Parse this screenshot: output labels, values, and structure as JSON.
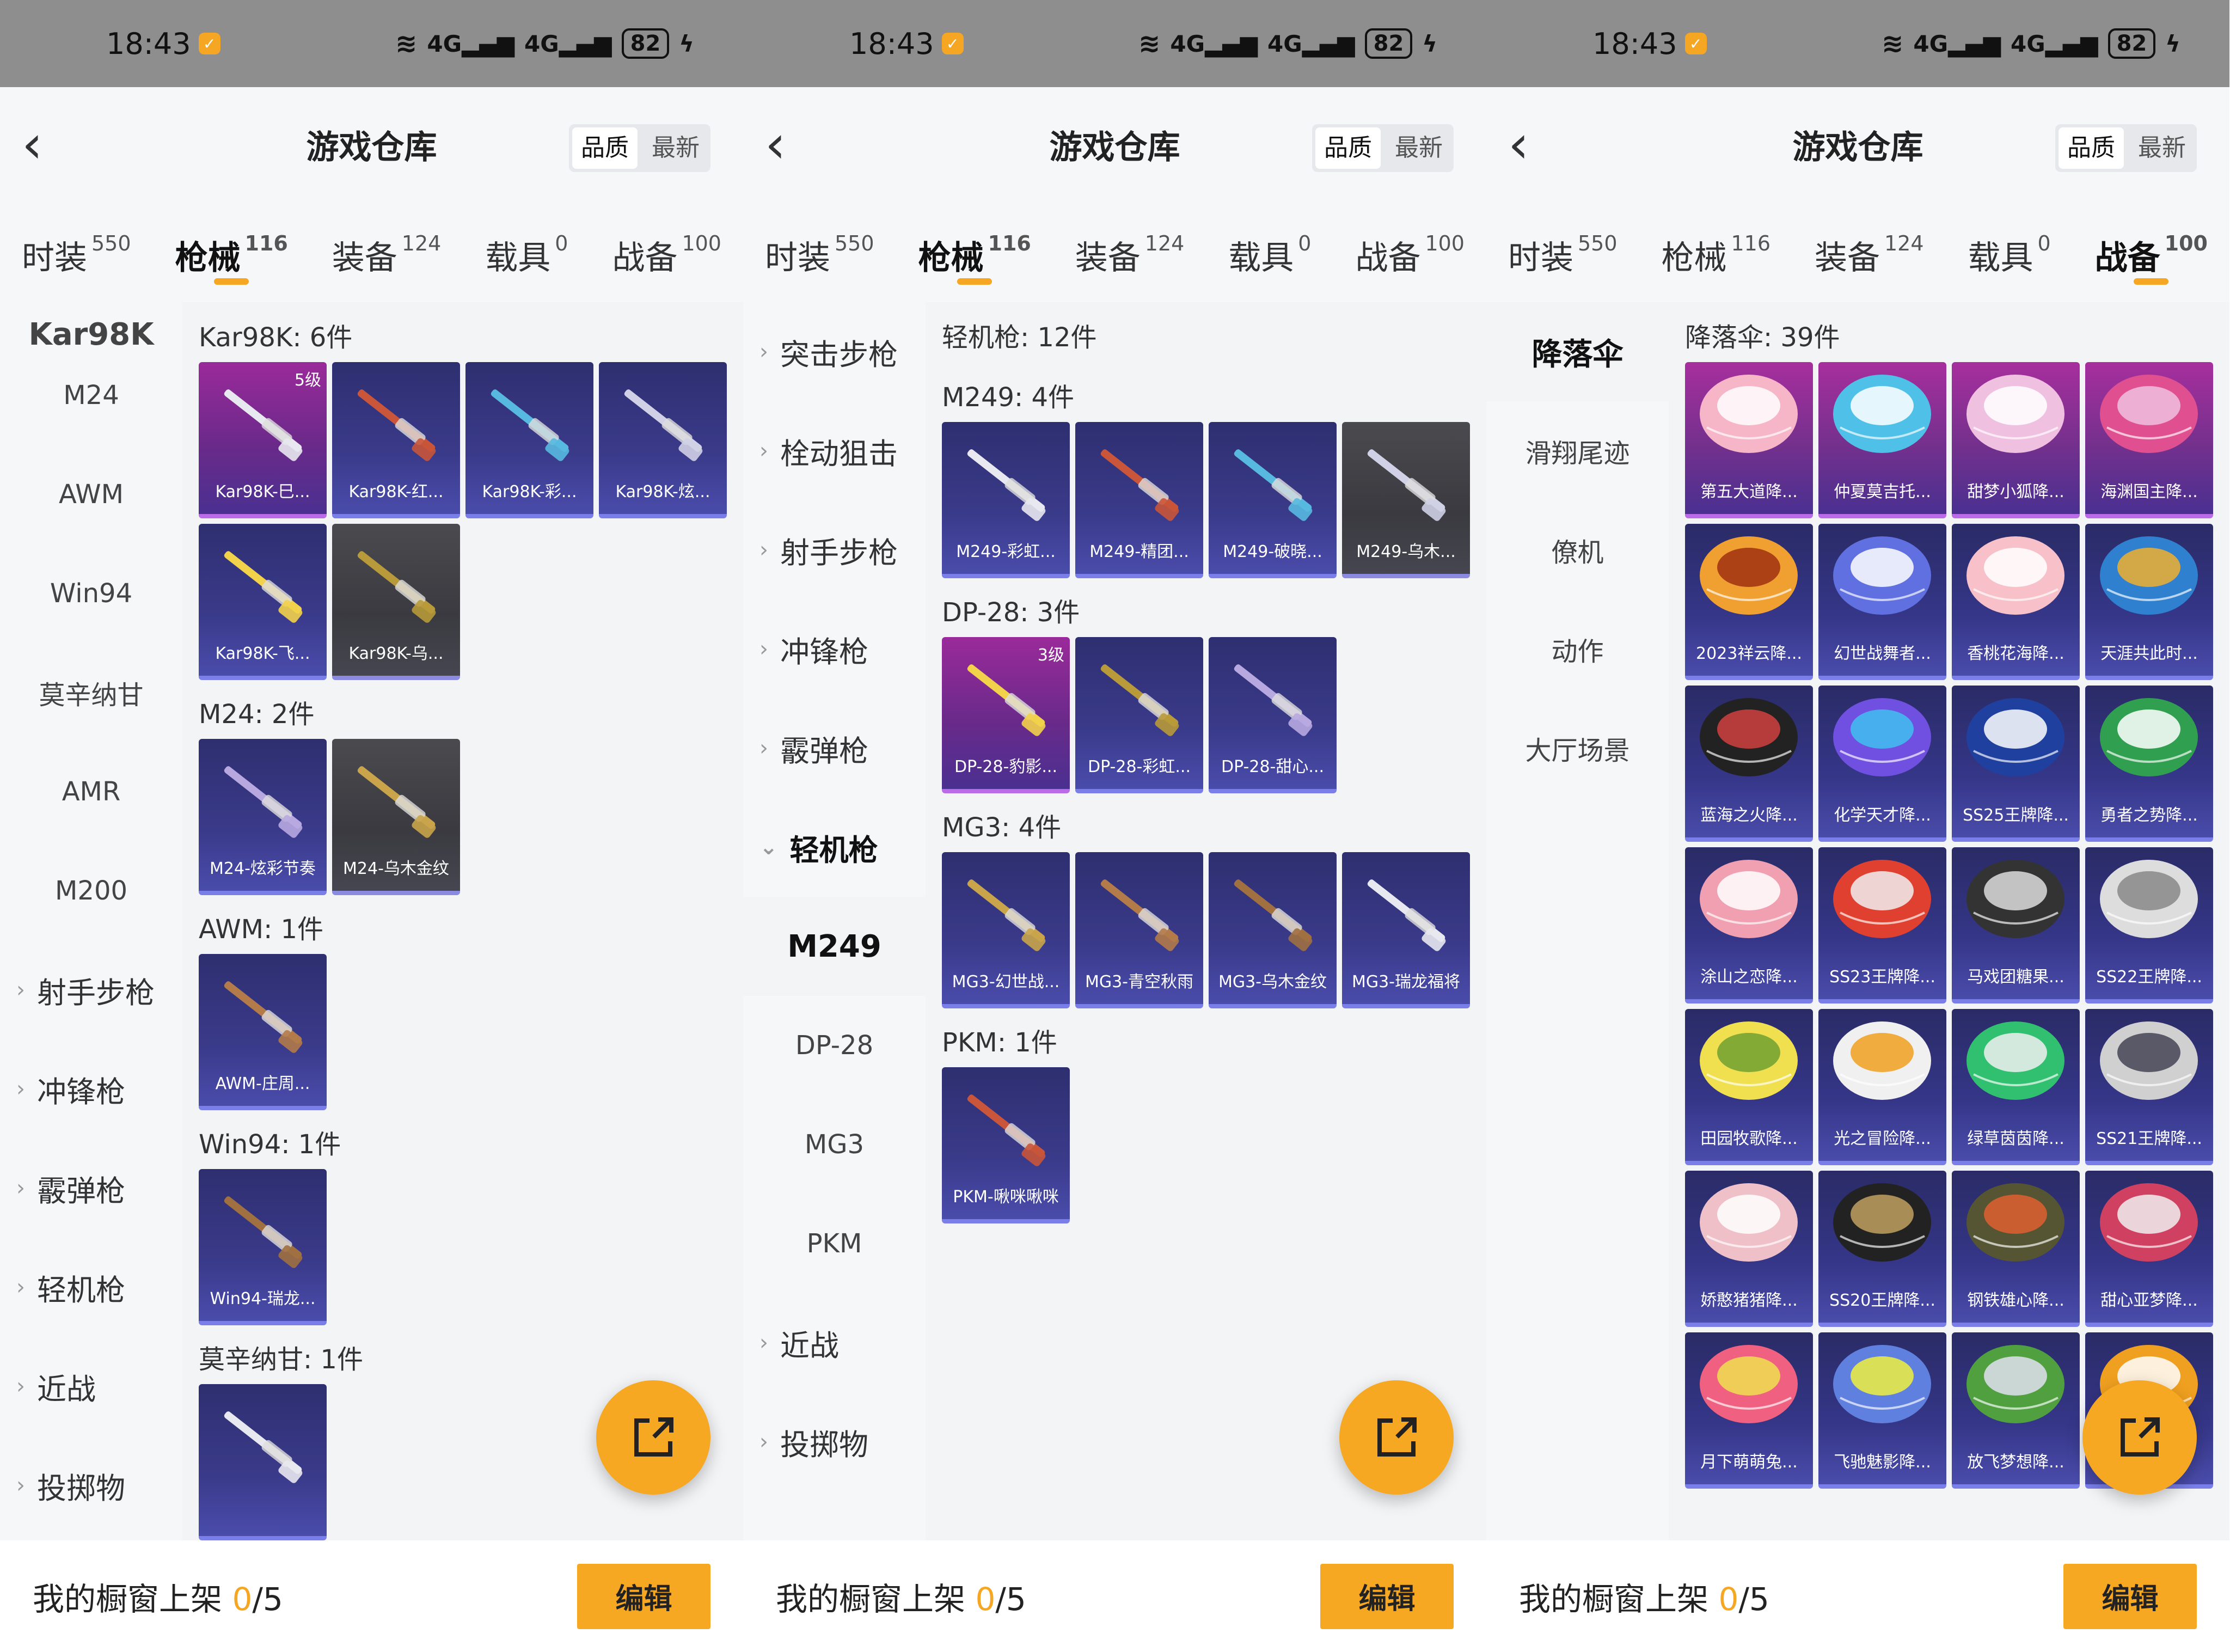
{
  "colors": {
    "accent": "#f5a623",
    "status_bar": "#8e8e8e"
  },
  "status": {
    "time": "18:43",
    "signal1": "4G",
    "signal2": "4G",
    "battery": "82"
  },
  "header": {
    "title": "游戏仓库",
    "sort_quality": "品质",
    "sort_newest": "最新"
  },
  "tabs": [
    {
      "label": "时装",
      "count": "550"
    },
    {
      "label": "枪械",
      "count": "116"
    },
    {
      "label": "装备",
      "count": "124"
    },
    {
      "label": "载具",
      "count": "0"
    },
    {
      "label": "战备",
      "count": "100"
    }
  ],
  "bottom": {
    "showcase_prefix": "我的橱窗上架 ",
    "showcase_count": "0",
    "showcase_total": "/5",
    "edit": "编辑"
  },
  "panel1": {
    "sidebar_cut": "Kar98K",
    "sidebar": [
      "M24",
      "AWM",
      "Win94",
      "莫辛纳甘",
      "AMR",
      "M200"
    ],
    "sidebar_cats": [
      "射手步枪",
      "冲锋枪",
      "霰弹枪",
      "轻机枪",
      "近战",
      "投掷物"
    ],
    "groups": [
      {
        "title": "Kar98K: 6件",
        "items": [
          {
            "label": "Kar98K-巳...",
            "level": "5级"
          },
          {
            "label": "Kar98K-红..."
          },
          {
            "label": "Kar98K-彩..."
          },
          {
            "label": "Kar98K-炫..."
          },
          {
            "label": "Kar98K-飞..."
          },
          {
            "label": "Kar98K-乌..."
          }
        ]
      },
      {
        "title": "M24: 2件",
        "items": [
          {
            "label": "M24-炫彩节奏"
          },
          {
            "label": "M24-乌木金纹"
          }
        ]
      },
      {
        "title": "AWM: 1件",
        "items": [
          {
            "label": "AWM-庄周..."
          }
        ]
      },
      {
        "title": "Win94: 1件",
        "items": [
          {
            "label": "Win94-瑞龙..."
          }
        ]
      },
      {
        "title": "莫辛纳甘: 1件",
        "items": [
          {
            "label": ""
          }
        ]
      }
    ]
  },
  "panel2": {
    "sidebar_cats_top": [
      "突击步枪",
      "栓动狙击",
      "射手步枪",
      "冲锋枪",
      "霰弹枪",
      "轻机枪"
    ],
    "sidebar_sub": [
      "M249",
      "DP-28",
      "MG3",
      "PKM"
    ],
    "sidebar_cats_bottom": [
      "近战",
      "投掷物"
    ],
    "section_title": "轻机枪: 12件",
    "groups": [
      {
        "title": "M249: 4件",
        "items": [
          {
            "label": "M249-彩虹..."
          },
          {
            "label": "M249-精团..."
          },
          {
            "label": "M249-破晓..."
          },
          {
            "label": "M249-乌木..."
          }
        ]
      },
      {
        "title": "DP-28: 3件",
        "items": [
          {
            "label": "DP-28-豹影...",
            "level": "3级"
          },
          {
            "label": "DP-28-彩虹..."
          },
          {
            "label": "DP-28-甜心..."
          }
        ]
      },
      {
        "title": "MG3: 4件",
        "items": [
          {
            "label": "MG3-幻世战..."
          },
          {
            "label": "MG3-青空秋雨"
          },
          {
            "label": "MG3-乌木金纹"
          },
          {
            "label": "MG3-瑞龙福将"
          }
        ]
      },
      {
        "title": "PKM: 1件",
        "items": [
          {
            "label": "PKM-啾咪啾咪"
          }
        ]
      }
    ]
  },
  "panel3": {
    "sidebar": [
      "降落伞",
      "滑翔尾迹",
      "僚机",
      "动作",
      "大厅场景"
    ],
    "groups": [
      {
        "title": "降落伞: 39件",
        "items": [
          {
            "label": "第五大道降..."
          },
          {
            "label": "仲夏莫吉托..."
          },
          {
            "label": "甜梦小狐降..."
          },
          {
            "label": "海渊国主降..."
          },
          {
            "label": "2023祥云降..."
          },
          {
            "label": "幻世战舞者..."
          },
          {
            "label": "香桃花海降..."
          },
          {
            "label": "天涯共此时..."
          },
          {
            "label": "蓝海之火降..."
          },
          {
            "label": "化学天才降..."
          },
          {
            "label": "SS25王牌降..."
          },
          {
            "label": "勇者之势降..."
          },
          {
            "label": "涂山之恋降..."
          },
          {
            "label": "SS23王牌降..."
          },
          {
            "label": "马戏团糖果..."
          },
          {
            "label": "SS22王牌降..."
          },
          {
            "label": "田园牧歌降..."
          },
          {
            "label": "光之冒险降..."
          },
          {
            "label": "绿草茵茵降..."
          },
          {
            "label": "SS21王牌降..."
          },
          {
            "label": "娇憨猪猪降..."
          },
          {
            "label": "SS20王牌降..."
          },
          {
            "label": "钢铁雄心降..."
          },
          {
            "label": "甜心亚梦降..."
          },
          {
            "label": "月下萌萌兔..."
          },
          {
            "label": "飞驰魅影降..."
          },
          {
            "label": "放飞梦想降..."
          },
          {
            "label": "..."
          }
        ]
      }
    ]
  }
}
